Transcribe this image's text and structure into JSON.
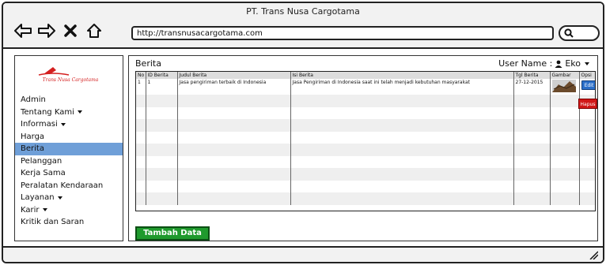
{
  "window": {
    "title": "PT. Trans Nusa Cargotama"
  },
  "browser": {
    "url": "http://transnusacargotama.com"
  },
  "sidebar": {
    "logo_text": "Trans Nusa Cargotama",
    "items": [
      {
        "label": "Admin",
        "caret": false,
        "active": false
      },
      {
        "label": "Tentang Kami",
        "caret": true,
        "active": false
      },
      {
        "label": "Informasi",
        "caret": true,
        "active": false
      },
      {
        "label": "Harga",
        "caret": false,
        "active": false
      },
      {
        "label": "Berita",
        "caret": false,
        "active": true
      },
      {
        "label": "Pelanggan",
        "caret": false,
        "active": false
      },
      {
        "label": "Kerja Sama",
        "caret": false,
        "active": false
      },
      {
        "label": "Peralatan Kendaraan",
        "caret": false,
        "active": false
      },
      {
        "label": "Layanan",
        "caret": true,
        "active": false
      },
      {
        "label": "Karir",
        "caret": true,
        "active": false
      },
      {
        "label": "Kritik dan Saran",
        "caret": false,
        "active": false
      }
    ]
  },
  "main": {
    "title": "Berita",
    "user_label": "User Name :",
    "user_value": "Eko",
    "table": {
      "headers": [
        "No",
        "ID Berita",
        "Judul Berita",
        "Isi Berita",
        "Tgl Berita",
        "Gambar",
        "Opsi"
      ],
      "rows": [
        [
          "1",
          "1",
          "Jasa pengiriman terbaik di Indonesia",
          "Jasa Pengiriman di Indonesia saat ini telah menjadi kebutuhan masyarakat",
          "27-12-2015",
          "",
          ""
        ]
      ]
    },
    "edit_label": "Edit",
    "delete_label": "Hapus",
    "add_button": "Tambah Data"
  },
  "colors": {
    "active_menu": "#6f9fd8",
    "edit_button": "#2b6fc9",
    "delete_button": "#d01818",
    "add_button": "#1f9a2d",
    "logo": "#d42020"
  }
}
